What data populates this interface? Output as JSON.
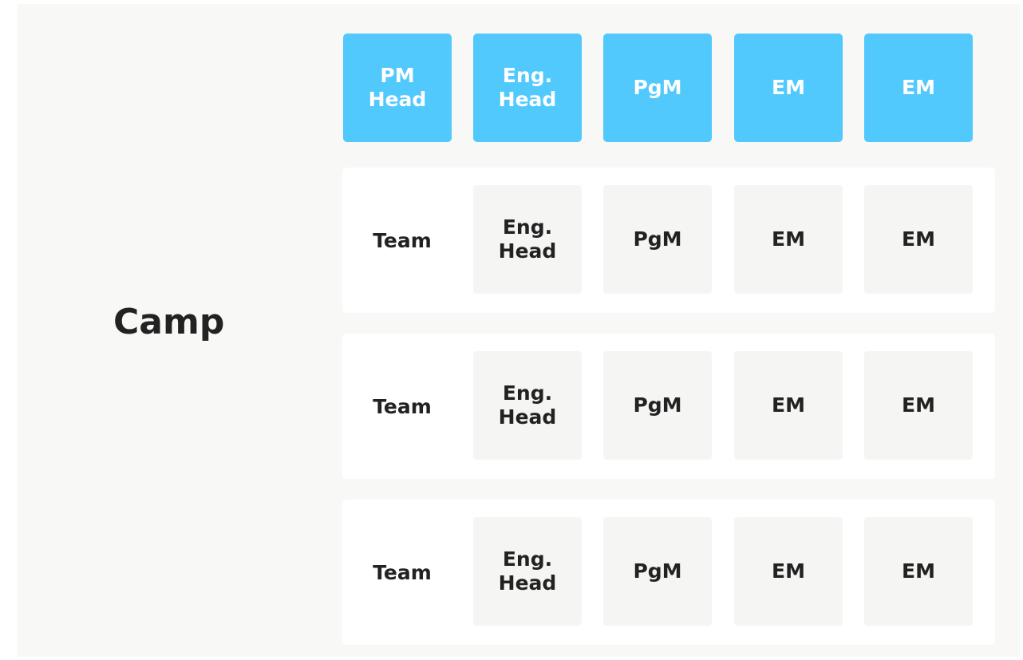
{
  "diagram": {
    "camp_label": "Camp",
    "colors": {
      "header_fill": "#52c9fd",
      "header_text": "#ffffff",
      "panel_background": "#f8f8f7",
      "row_background": "#ffffff",
      "cell_background": "#f5f5f4",
      "text": "#222222"
    },
    "header_roles": [
      "PM\nHead",
      "Eng.\nHead",
      "PgM",
      "EM",
      "EM"
    ],
    "teams": [
      {
        "label": "Team",
        "roles": [
          "Eng.\nHead",
          "PgM",
          "EM",
          "EM"
        ]
      },
      {
        "label": "Team",
        "roles": [
          "Eng.\nHead",
          "PgM",
          "EM",
          "EM"
        ]
      },
      {
        "label": "Team",
        "roles": [
          "Eng.\nHead",
          "PgM",
          "EM",
          "EM"
        ]
      }
    ]
  }
}
